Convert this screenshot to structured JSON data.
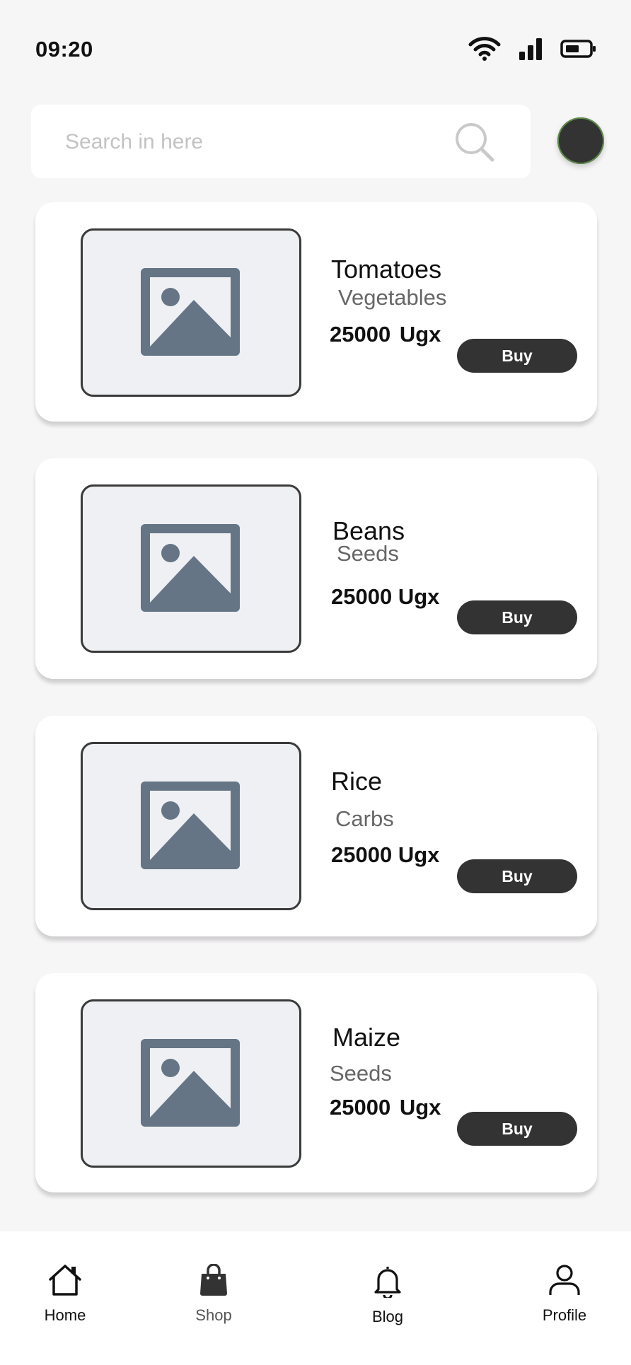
{
  "status": {
    "time": "09:20",
    "icons": [
      "wifi-icon",
      "signal-icon",
      "battery-icon"
    ]
  },
  "search": {
    "placeholder": "Search in here",
    "value": "",
    "icon": "search-icon"
  },
  "avatar": {
    "icon": "avatar"
  },
  "products": [
    {
      "name": "Tomatoes",
      "category": "Vegetables",
      "price_amount": "25000",
      "price_currency": "Ugx",
      "buy_label": "Buy"
    },
    {
      "name": "Beans",
      "category": "Seeds",
      "price_amount": "25000",
      "price_currency": "Ugx",
      "buy_label": "Buy"
    },
    {
      "name": "Rice",
      "category": "Carbs",
      "price_amount": "25000",
      "price_currency": "Ugx",
      "buy_label": "Buy"
    },
    {
      "name": "Maize",
      "category": "Seeds",
      "price_amount": "25000",
      "price_currency": "Ugx",
      "buy_label": "Buy"
    }
  ],
  "nav": [
    {
      "label": "Home",
      "icon": "home-icon"
    },
    {
      "label": "Shop",
      "icon": "shopping-bag-icon"
    },
    {
      "label": "Blog",
      "icon": "bell-icon"
    },
    {
      "label": "Profile",
      "icon": "user-icon"
    }
  ],
  "colors": {
    "background": "#f7f6f7",
    "card": "#ffffff",
    "button": "#333333",
    "placeholder_bg": "#eef0f3",
    "image_icon": "#667585"
  }
}
